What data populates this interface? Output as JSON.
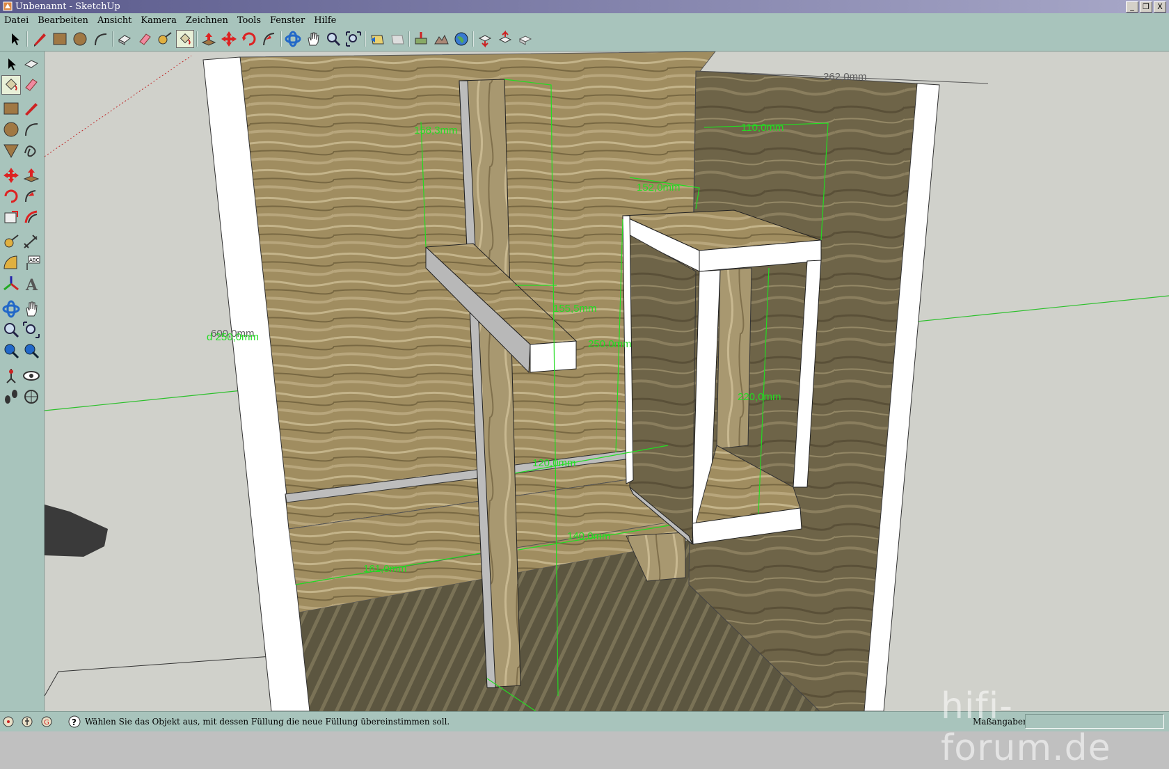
{
  "window": {
    "title": "Unbenannt - SketchUp",
    "buttons": [
      "_",
      "❐",
      "X"
    ]
  },
  "menu": {
    "items": [
      "Datei",
      "Bearbeiten",
      "Ansicht",
      "Kamera",
      "Zeichnen",
      "Tools",
      "Fenster",
      "Hilfe"
    ]
  },
  "toolbar": {
    "tools": [
      "select-icon",
      "pencil-icon",
      "rectangle-icon",
      "circle-icon",
      "arc-icon",
      "make-component-icon",
      "eraser-icon",
      "tape-measure-icon",
      "paint-bucket-icon",
      "push-pull-icon",
      "move-icon",
      "rotate-icon",
      "follow-me-icon",
      "orbit-icon",
      "pan-icon",
      "zoom-icon",
      "zoom-extents-icon",
      "previous-view-icon",
      "next-view-icon",
      "add-location-icon",
      "toggle-terrain-icon",
      "google-earth-icon",
      "get-models-icon",
      "share-model-icon",
      "share-component-icon"
    ]
  },
  "dimensions": {
    "d1": "262,0mm",
    "d2": "110,0mm",
    "d3": "152,0mm",
    "d4": "158,3mm",
    "d5": "155,5mm",
    "d6": "250,0mm",
    "d7": "600,0mm",
    "d8": "d 250,0mm",
    "d9": "220,0mm",
    "d10": "120,0mm",
    "d11": "140,0mm",
    "d12": "161,0mm"
  },
  "status": {
    "hint": "Wählen Sie das Objekt aus, mit dessen Füllung die neue Füllung übereinstimmen soll.",
    "vcb_label": "Maßangaben",
    "vcb_value": ""
  },
  "watermark": "hifi-forum.de",
  "colors": {
    "ui": "#a8c4bc",
    "title_gradient_start": "#5a5a8c",
    "dimension": "#22dd22",
    "wood": "#9c8a5e",
    "panel_edge": "#ffffff",
    "sky": "#d0d1cb"
  }
}
